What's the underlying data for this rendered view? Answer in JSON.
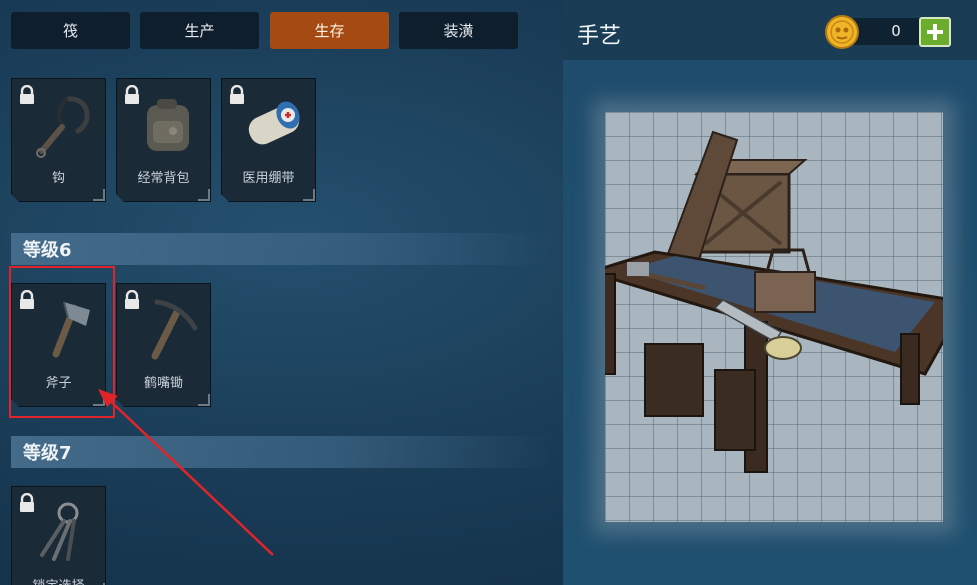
{
  "tabs": [
    {
      "label": "筏",
      "active": false
    },
    {
      "label": "生产",
      "active": false
    },
    {
      "label": "生存",
      "active": true
    },
    {
      "label": "装潢",
      "active": false
    }
  ],
  "sections": [
    {
      "header": "",
      "items": [
        {
          "label": "钩",
          "locked": true,
          "icon": "hook-icon"
        },
        {
          "label": "经常背包",
          "locked": true,
          "icon": "backpack-icon"
        },
        {
          "label": "医用绷带",
          "locked": true,
          "icon": "bandage-icon"
        }
      ]
    },
    {
      "header": "等级6",
      "items": [
        {
          "label": "斧子",
          "locked": true,
          "icon": "axe-icon"
        },
        {
          "label": "鹤嘴锄",
          "locked": true,
          "icon": "pickaxe-icon"
        }
      ]
    },
    {
      "header": "等级7",
      "items": [
        {
          "label": "锁定选择",
          "locked": true,
          "icon": "lockpick-icon"
        }
      ]
    }
  ],
  "panel": {
    "title": "手艺",
    "coins": "0",
    "preview_icon": "workbench-icon"
  },
  "colors": {
    "active_tab": "#a54a13",
    "highlight": "#e0242a",
    "plus_button": "#6cad2e"
  }
}
